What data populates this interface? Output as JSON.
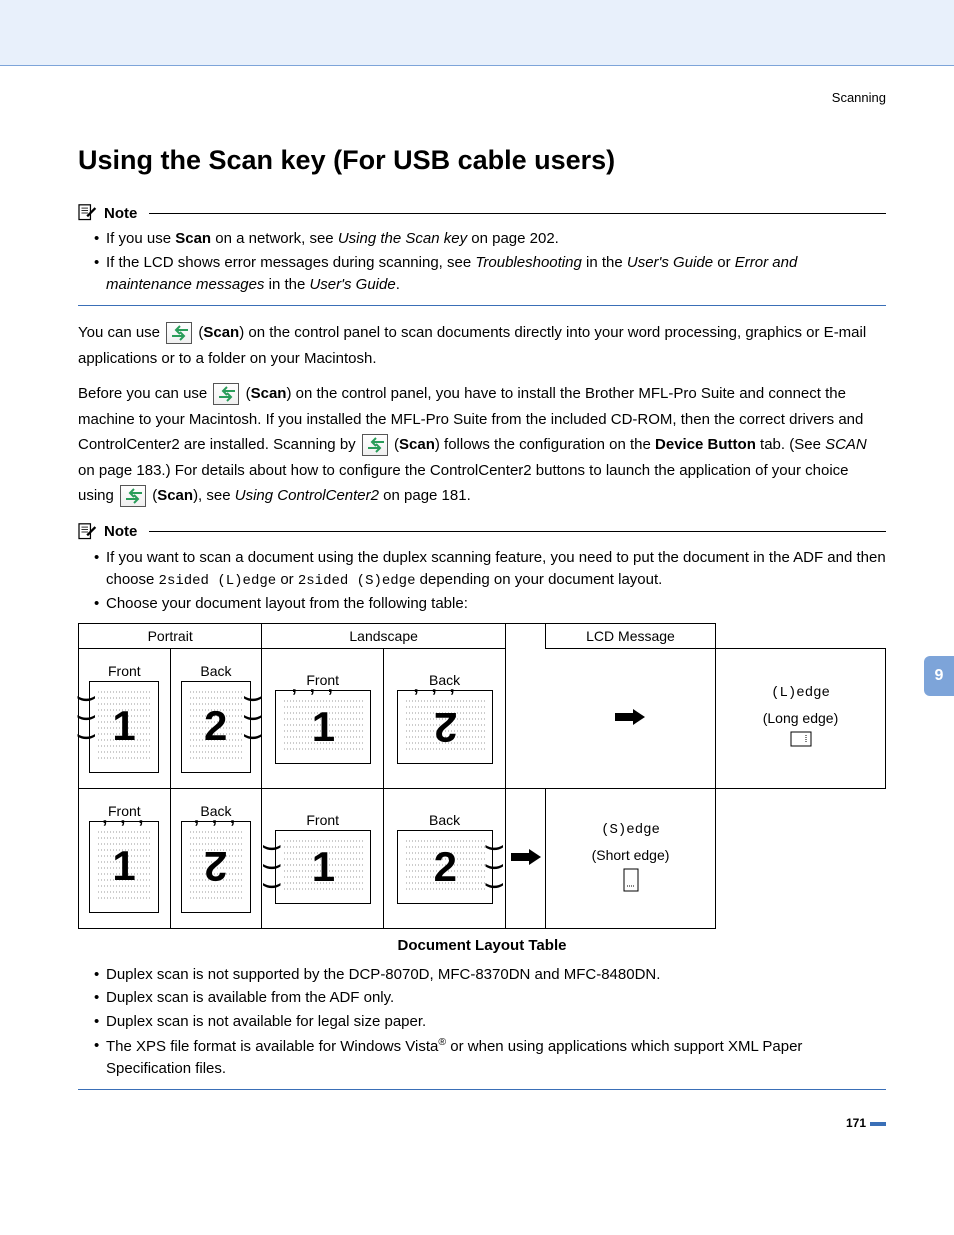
{
  "header": {
    "breadcrumb": "Scanning"
  },
  "title": "Using the Scan key (For USB cable users)",
  "note1": {
    "label": "Note",
    "b1_a": "If you use ",
    "b1_b": "Scan",
    "b1_c": " on a network, see ",
    "b1_d": "Using the Scan key",
    "b1_e": " on page 202.",
    "b2_a": "If the LCD shows error messages during scanning, see ",
    "b2_b": "Troubleshooting",
    "b2_c": " in the ",
    "b2_d": "User's Guide",
    "b2_e": " or ",
    "b2_f": "Error and maintenance messages",
    "b2_g": " in the ",
    "b2_h": "User's Guide",
    "b2_i": "."
  },
  "body": {
    "p1_a": "You can use ",
    "p1_b": " (",
    "p1_c": "Scan",
    "p1_d": ") on the control panel to scan documents directly into your word processing, graphics or E-mail applications or to a folder on your Macintosh.",
    "p2_a": "Before you can use ",
    "p2_b": " (",
    "p2_c": "Scan",
    "p2_d": ") on the control panel, you have to install the Brother MFL-Pro Suite and connect the machine to your Macintosh. If you installed the MFL-Pro Suite from the included CD-ROM, then the correct drivers and ControlCenter2 are installed. Scanning by ",
    "p2_e": " (",
    "p2_f": "Scan",
    "p2_g": ") follows the configuration on the ",
    "p2_h": "Device Button",
    "p2_i": " tab. (See ",
    "p2_j": "SCAN",
    "p2_k": " on page 183.) For details about how to configure the ControlCenter2 buttons to launch the application of your choice using ",
    "p2_l": " (",
    "p2_m": "Scan",
    "p2_n": "), see ",
    "p2_o": "Using ControlCenter2",
    "p2_p": " on page 181."
  },
  "note2": {
    "label": "Note",
    "b1_a": "If you want to scan a document using the duplex scanning feature, you need to put the document in the ADF and then choose ",
    "b1_b": "2sided (L)edge",
    "b1_c": " or ",
    "b1_d": "2sided (S)edge",
    "b1_e": " depending on your document layout.",
    "b2": "Choose your document layout from the following table:"
  },
  "table": {
    "h_portrait": "Portrait",
    "h_landscape": "Landscape",
    "h_lcd": "LCD Message",
    "front": "Front",
    "back": "Back",
    "lcd1_code": "(L)edge",
    "lcd1_label": "(Long edge)",
    "lcd2_code": "(S)edge",
    "lcd2_label": "(Short edge)",
    "caption": "Document Layout Table"
  },
  "bullets2": {
    "b1": "Duplex scan is not supported by the DCP-8070D, MFC-8370DN and MFC-8480DN.",
    "b2": "Duplex scan is available from the ADF only.",
    "b3": "Duplex scan is not available for legal size paper.",
    "b4_a": "The XPS file format is available for Windows Vista",
    "b4_b": " or when using applications which support XML Paper Specification files."
  },
  "sidebar": {
    "chapter": "9"
  },
  "footer": {
    "page": "171"
  }
}
